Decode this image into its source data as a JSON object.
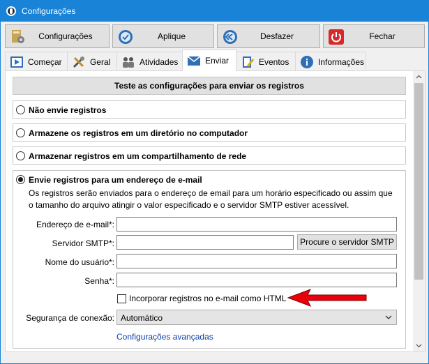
{
  "window": {
    "title": "Configurações"
  },
  "toolbar": {
    "settings_label": "Configurações",
    "apply_label": "Aplique",
    "undo_label": "Desfazer",
    "close_label": "Fechar"
  },
  "tabs": [
    {
      "label": "Começar"
    },
    {
      "label": "Geral"
    },
    {
      "label": "Atividades"
    },
    {
      "label": "Enviar"
    },
    {
      "label": "Eventos"
    },
    {
      "label": "Informações"
    }
  ],
  "panel": {
    "test_header": "Teste as configurações para enviar os registros",
    "options": [
      {
        "label": "Não envie registros",
        "checked": false
      },
      {
        "label": "Armazene os registros em um diretório no computador",
        "checked": false
      },
      {
        "label": "Armazenar registros em um compartilhamento de rede",
        "checked": false
      },
      {
        "label": "Envie registros para um endereço de e-mail",
        "checked": true
      }
    ],
    "email": {
      "description": "Os registros serão enviados para o endereço de email para um horário especificado ou assim que o tamanho do arquivo atingir o valor especificado e o servidor SMTP estiver acessível.",
      "address_label": "Endereço de e-mail*:",
      "address_value": "",
      "smtp_label": "Servidor SMTP*:",
      "smtp_value": "",
      "find_smtp_label": "Procure o servidor SMTP",
      "username_label": "Nome do usuário*:",
      "username_value": "",
      "password_label": "Senha*:",
      "password_value": "",
      "html_checkbox_label": "Incorporar registros no e-mail como HTML",
      "html_checkbox_checked": false,
      "security_label": "Segurança de conexão:",
      "security_value": "Automático",
      "advanced_link": "Configurações avançadas"
    }
  },
  "colors": {
    "titlebar": "#1883d7",
    "link": "#0b3fa8",
    "arrow": "#e8000b"
  }
}
